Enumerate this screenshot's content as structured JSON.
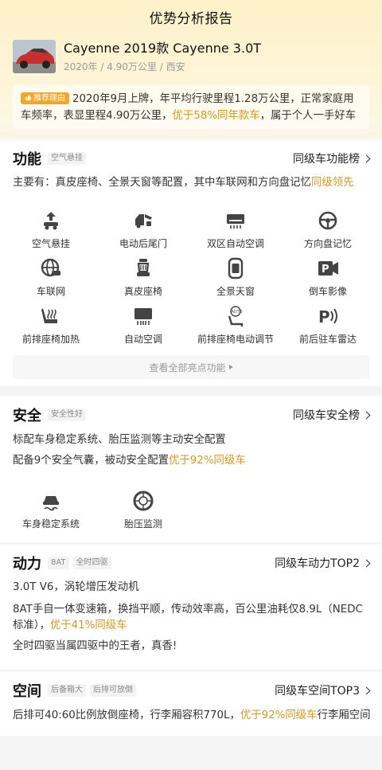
{
  "nav": {
    "title": "优势分析报告"
  },
  "car": {
    "name": "Cayenne 2019款 Cayenne 3.0T",
    "meta": "2020年 / 4.90万公里 / 西安",
    "reason_tag": "推荐理由",
    "reason_a": "2020年9月上牌，年平均行驶里程1.28万公里，正常家庭用车频率，表显里程4.90万公里，",
    "reason_highlight": "优于58%同年款车",
    "reason_b": "，属于个人一手好车"
  },
  "function": {
    "title": "功能",
    "chip": "空气悬挂",
    "rank": "同级车功能榜",
    "summary_a": "主要有：真皮座椅、全景天窗等配置，其中车联网和方向盘记忆",
    "summary_highlight": "同级领先",
    "features": [
      {
        "label": "空气悬挂",
        "icon": "air-suspension-icon"
      },
      {
        "label": "电动后尾门",
        "icon": "power-tailgate-icon"
      },
      {
        "label": "双区自动空调",
        "icon": "dual-zone-ac-icon"
      },
      {
        "label": "方向盘记忆",
        "icon": "steering-memory-icon"
      },
      {
        "label": "车联网",
        "icon": "connected-car-icon"
      },
      {
        "label": "真皮座椅",
        "icon": "leather-seat-icon"
      },
      {
        "label": "全景天窗",
        "icon": "panoramic-sunroof-icon"
      },
      {
        "label": "倒车影像",
        "icon": "rear-camera-icon"
      },
      {
        "label": "前排座椅加热",
        "icon": "seat-heating-icon"
      },
      {
        "label": "自动空调",
        "icon": "auto-ac-icon"
      },
      {
        "label": "前排座椅电动调节",
        "icon": "power-seat-icon"
      },
      {
        "label": "前后驻车雷达",
        "icon": "parking-radar-icon"
      }
    ],
    "more": "查看全部亮点功能"
  },
  "safety": {
    "title": "安全",
    "chip": "安全性好",
    "rank": "同级车安全榜",
    "line1": "标配车身稳定系统、胎压监测等主动安全配置",
    "line2_a": "配备9个安全气囊，被动安全配置",
    "line2_highlight": "优于92%同级车",
    "features": [
      {
        "label": "车身稳定系统",
        "icon": "stability-control-icon"
      },
      {
        "label": "胎压监测",
        "icon": "tire-pressure-icon"
      }
    ]
  },
  "power": {
    "title": "动力",
    "chip1": "8AT",
    "chip2": "全时四驱",
    "rank": "同级车动力TOP2",
    "line1": "3.0T V6，涡轮增压发动机",
    "line2": "8AT手自一体变速箱，换挡平顺，传动效率高，百公里油耗仅8.9L（NEDC",
    "line3_a": "标准），",
    "line3_highlight": "优于41%同级车",
    "line4": "全时四驱当属四驱中的王者，真香!"
  },
  "space": {
    "title": "空间",
    "chip1": "后备箱大",
    "chip2": "后排可放倒",
    "rank": "同级车空间TOP3",
    "line1_a": "后排可40:60比例放倒座椅，行李厢容积770L，",
    "line1_highlight": "优于92%同级车",
    "line1_b": "行李厢空间"
  },
  "colors": {
    "accent": "#d59a1a",
    "tag": "#f5a623"
  }
}
